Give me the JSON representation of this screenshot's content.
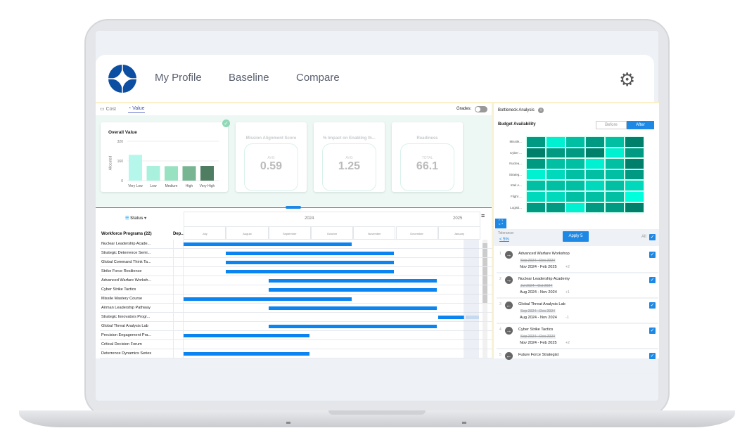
{
  "nav": {
    "items": [
      "My Profile",
      "Baseline",
      "Compare"
    ]
  },
  "tabs": [
    "Cost",
    "Value"
  ],
  "active_tab": "Value",
  "grades_label": "Grades:",
  "overall": {
    "title": "Overall Value",
    "ylabel": "Allocated",
    "yticks": [
      "320",
      "160",
      "0"
    ],
    "categories": [
      "Very Low",
      "Low",
      "Medium",
      "High",
      "Very High"
    ],
    "values": [
      210,
      120,
      118,
      118,
      120
    ],
    "ymax": 320,
    "colors": [
      "#b5f7ea",
      "#a9f1dc",
      "#98e2c2",
      "#78b592",
      "#4f7d62"
    ]
  },
  "metrics": [
    {
      "title": "Mission Alignment Score",
      "label": "AVG",
      "value": "0.59"
    },
    {
      "title": "% Impact on Enabling th...",
      "label": "AVG",
      "value": "1.25"
    },
    {
      "title": "Readiness",
      "label": "TOTAL",
      "value": "66.1"
    }
  ],
  "gantt": {
    "status_label": "Status",
    "col_programs": "Workforce Programs (22)",
    "col_dep": "Dep...",
    "years": [
      "2024",
      "2025"
    ],
    "months": [
      "July",
      "August",
      "September",
      "October",
      "November",
      "December",
      "January"
    ],
    "rows": [
      {
        "name": "Nuclear Leadership Acade...",
        "start": 0,
        "end": 4
      },
      {
        "name": "Strategic Deterrence Semi...",
        "start": 1,
        "end": 5
      },
      {
        "name": "Global Command Think Ta...",
        "start": 1,
        "end": 5
      },
      {
        "name": "Strike Force Resilience",
        "start": 1,
        "end": 5
      },
      {
        "name": "Advanced Warfare Worksh...",
        "start": 2,
        "end": 6
      },
      {
        "name": "Cyber Strike Tactics",
        "start": 2,
        "end": 6
      },
      {
        "name": "Missile Mastery Course",
        "start": 0,
        "end": 4
      },
      {
        "name": "Airman Leadership Pathway",
        "start": 2,
        "end": 6
      },
      {
        "name": "Strategic Innovators Progr...",
        "start": 6,
        "end": 6.65
      },
      {
        "name": "Global Threat Analysis Lab",
        "start": 2,
        "end": 6
      },
      {
        "name": "Precision Engagement Pra...",
        "start": 0,
        "end": 3
      },
      {
        "name": "Critical Decision Forum",
        "start": null,
        "end": null
      },
      {
        "name": "Deterrence Dynamics Series",
        "start": 0,
        "end": 3
      }
    ]
  },
  "bottleneck": {
    "title": "Bottleneck Analysis",
    "subtitle": "Budget Availability",
    "toggle": [
      "Before",
      "After"
    ],
    "active": "After",
    "rows": [
      "Missile...",
      "Cyber ...",
      "Nuclea...",
      "Strateg...",
      "Intel A...",
      "Flight ...",
      "Logisti..."
    ],
    "levels": [
      [
        4,
        1,
        3,
        4,
        3,
        5
      ],
      [
        5,
        4,
        4,
        5,
        1,
        4
      ],
      [
        4,
        3,
        3,
        1,
        3,
        5
      ],
      [
        1,
        2,
        3,
        3,
        3,
        4
      ],
      [
        3,
        3,
        3,
        2,
        3,
        2
      ],
      [
        2,
        2,
        3,
        3,
        3,
        0
      ],
      [
        4,
        4,
        1,
        4,
        4,
        5
      ]
    ],
    "palette": [
      "#00ffdc",
      "#00f0d2",
      "#00d9bc",
      "#00bfa3",
      "#009a82",
      "#007f6b"
    ]
  },
  "tolerance": {
    "label": "Tolerance:",
    "value": "< 5%",
    "apply": "Apply 5",
    "all": "All"
  },
  "moves": [
    {
      "n": "1",
      "dir": "right",
      "name": "Advanced Warfare Workshop",
      "old": "Sep 2024 - Dec 2024",
      "new": "Nov 2024 - Feb 2025",
      "delta": "+2"
    },
    {
      "n": "2",
      "dir": "right",
      "name": "Nuclear Leadership Academy",
      "old": "Jul 2024 - Oct 2024",
      "new": "Aug 2024 - Nov 2024",
      "delta": "+1"
    },
    {
      "n": "3",
      "dir": "left",
      "name": "Global Threat Analysis Lab",
      "old": "Sep 2024 - Dec 2024",
      "new": "Aug 2024 - Nov 2024",
      "delta": "-1"
    },
    {
      "n": "4",
      "dir": "right",
      "name": "Cyber Strike Tactics",
      "old": "Sep 2024 - Dec 2024",
      "new": "Nov 2024 - Feb 2025",
      "delta": "+2"
    },
    {
      "n": "5",
      "dir": "left",
      "name": "Future Force Strategist",
      "old": "",
      "new": "",
      "delta": ""
    }
  ]
}
